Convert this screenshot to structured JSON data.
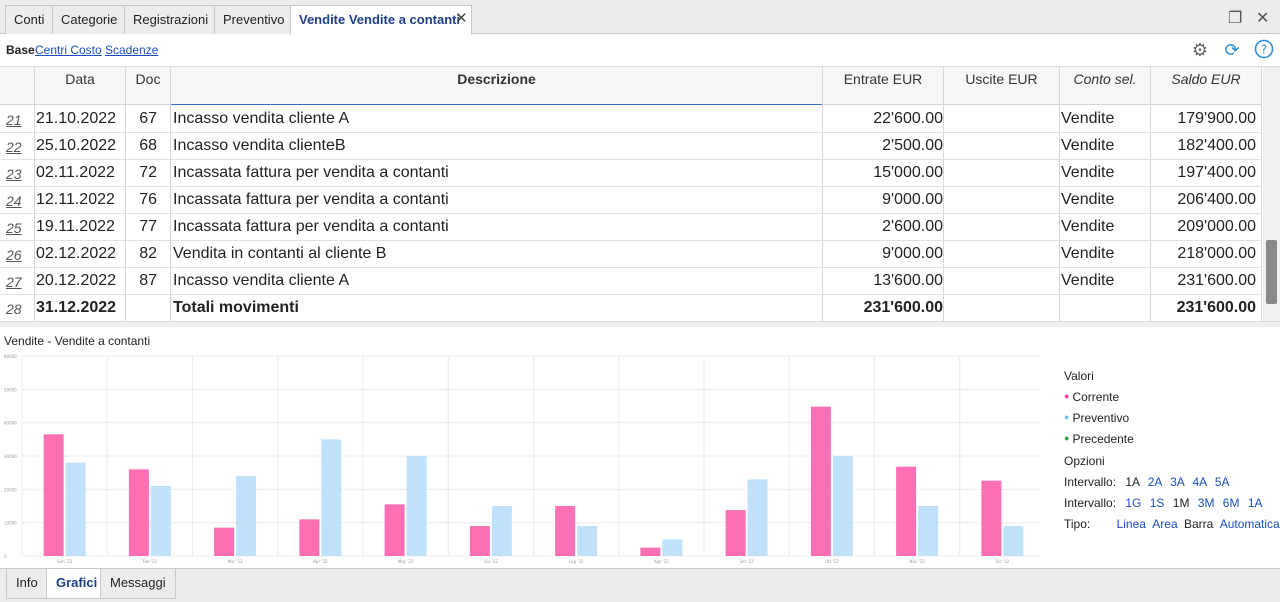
{
  "tabs": [
    {
      "label": "Conti"
    },
    {
      "label": "Categorie"
    },
    {
      "label": "Registrazioni"
    },
    {
      "label": "Preventivo"
    },
    {
      "label": "Vendite Vendite a contanti"
    }
  ],
  "secondary": {
    "base": "Base",
    "links": [
      "Centri Costo",
      "Scadenze"
    ]
  },
  "columns": [
    "Data",
    "Doc",
    "Descrizione",
    "Entrate EUR",
    "Uscite EUR",
    "Conto sel.",
    "Saldo EUR"
  ],
  "rows": [
    {
      "n": "21",
      "date": "21.10.2022",
      "doc": "67",
      "desc": "Incasso vendita cliente A",
      "entrate": "22'600.00",
      "uscite": "",
      "conto": "Vendite",
      "saldo": "179'900.00"
    },
    {
      "n": "22",
      "date": "25.10.2022",
      "doc": "68",
      "desc": "Incasso vendita clienteB",
      "entrate": "2'500.00",
      "uscite": "",
      "conto": "Vendite",
      "saldo": "182'400.00"
    },
    {
      "n": "23",
      "date": "02.11.2022",
      "doc": "72",
      "desc": "Incassata fattura per vendita a contanti",
      "entrate": "15'000.00",
      "uscite": "",
      "conto": "Vendite",
      "saldo": "197'400.00"
    },
    {
      "n": "24",
      "date": "12.11.2022",
      "doc": "76",
      "desc": "Incassata fattura per vendita a contanti",
      "entrate": "9'000.00",
      "uscite": "",
      "conto": "Vendite",
      "saldo": "206'400.00"
    },
    {
      "n": "25",
      "date": "19.11.2022",
      "doc": "77",
      "desc": "Incassata fattura per vendita a contanti",
      "entrate": "2'600.00",
      "uscite": "",
      "conto": "Vendite",
      "saldo": "209'000.00"
    },
    {
      "n": "26",
      "date": "02.12.2022",
      "doc": "82",
      "desc": "Vendita in contanti al cliente B",
      "entrate": "9'000.00",
      "uscite": "",
      "conto": "Vendite",
      "saldo": "218'000.00"
    },
    {
      "n": "27",
      "date": "20.12.2022",
      "doc": "87",
      "desc": "Incasso vendita cliente A",
      "entrate": "13'600.00",
      "uscite": "",
      "conto": "Vendite",
      "saldo": "231'600.00"
    },
    {
      "n": "28",
      "date": "31.12.2022",
      "doc": "",
      "desc": "Totali movimenti",
      "entrate": "231'600.00",
      "uscite": "",
      "conto": "",
      "saldo": "231'600.00"
    }
  ],
  "chart_title": "Vendite - Vendite a contanti",
  "side": {
    "valori": "Valori",
    "legend": [
      {
        "label": "Corrente",
        "color": "#ff6fb4"
      },
      {
        "label": "Preventivo",
        "color": "#a8d8f0"
      },
      {
        "label": "Precedente",
        "color": "#2aa84a"
      }
    ],
    "opzioni": "Opzioni",
    "intervallo_label": "Intervallo:",
    "int1": [
      "1A",
      "2A",
      "3A",
      "4A",
      "5A"
    ],
    "int2": [
      "1G",
      "1S",
      "1M",
      "3M",
      "6M",
      "1A"
    ],
    "tipo_label": "Tipo:",
    "tipo": [
      "Linea",
      "Area",
      "Barra",
      "Automatica"
    ]
  },
  "bottom_tabs": [
    "Info",
    "Grafici",
    "Messaggi"
  ],
  "chart_data": {
    "type": "bar",
    "categories": [
      "Gen '22",
      "Feb '22",
      "Mar '22",
      "Apr '22",
      "May '22",
      "Giu '22",
      "Lug '22",
      "Ago '22",
      "Set '22",
      "Ott '22",
      "Nov '22",
      "Dic '22"
    ],
    "series": [
      {
        "name": "Corrente",
        "color": "#ff6fb4",
        "values": [
          36500,
          26000,
          8500,
          11000,
          15500,
          9000,
          15000,
          2500,
          13800,
          44800,
          26800,
          22600
        ]
      },
      {
        "name": "Preventivo",
        "color": "#bfe2fa",
        "values": [
          28000,
          21000,
          24000,
          35000,
          30000,
          15000,
          9000,
          5000,
          23000,
          30000,
          15000,
          9000
        ]
      }
    ],
    "yticks": [
      "0",
      "10000",
      "20000",
      "30000",
      "40000",
      "50000",
      "60000"
    ],
    "ylim": [
      0,
      60000
    ],
    "grid": true
  }
}
